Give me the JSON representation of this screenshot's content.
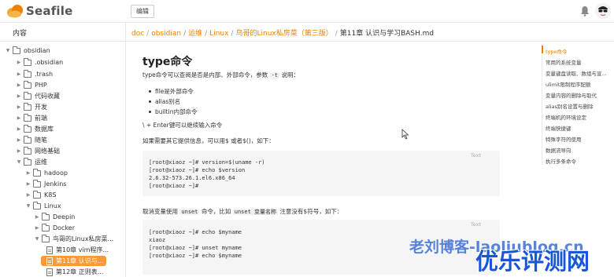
{
  "app": {
    "name": "Seafile",
    "brand_color": "#eb8205"
  },
  "toolbar": {
    "edit_label": "编辑"
  },
  "sidebar": {
    "title": "内容",
    "tree": [
      {
        "label": "obsidian",
        "type": "folder",
        "arrow": "▼"
      },
      {
        "label": ".obsidian",
        "type": "folder",
        "arrow": "▶"
      },
      {
        "label": ".trash",
        "type": "folder",
        "arrow": "▶"
      },
      {
        "label": "PHP",
        "type": "folder",
        "arrow": "▶"
      },
      {
        "label": "代码收藏",
        "type": "folder",
        "arrow": "▶"
      },
      {
        "label": "开发",
        "type": "folder",
        "arrow": "▶"
      },
      {
        "label": "前端",
        "type": "folder",
        "arrow": "▶"
      },
      {
        "label": "数据库",
        "type": "folder",
        "arrow": "▶"
      },
      {
        "label": "随笔",
        "type": "folder",
        "arrow": "▶"
      },
      {
        "label": "网络基础",
        "type": "folder",
        "arrow": "▶"
      },
      {
        "label": "运维",
        "type": "folder",
        "arrow": "▼"
      },
      {
        "label": "hadoop",
        "type": "folder",
        "arrow": "▶"
      },
      {
        "label": "Jenkins",
        "type": "folder",
        "arrow": "▶"
      },
      {
        "label": "K8S",
        "type": "folder",
        "arrow": "▶"
      },
      {
        "label": "Linux",
        "type": "folder",
        "arrow": "▼"
      },
      {
        "label": "Deepin",
        "type": "folder",
        "arrow": "▶"
      },
      {
        "label": "Docker",
        "type": "folder",
        "arrow": "▶"
      },
      {
        "label": "鸟哥的Linux私房菜...",
        "type": "folder",
        "arrow": "▼"
      },
      {
        "label": "第10章 vim程序...",
        "type": "file",
        "arrow": ""
      },
      {
        "label": "第11章 认识与...",
        "type": "file",
        "arrow": "",
        "active": true
      },
      {
        "label": "第12章 正则表...",
        "type": "file",
        "arrow": ""
      }
    ]
  },
  "breadcrumb": {
    "links": [
      "doc",
      "obsidian",
      "运维",
      "Linux",
      "鸟哥的Linux私房菜（第三版）"
    ],
    "separator": "/",
    "current": "第11章 认识与学习BASH.md"
  },
  "doc": {
    "title": "type命令",
    "intro_pre": "type命令可以查阅是否是内部、外部命令，参数 ",
    "intro_code": "-t",
    "intro_post": " 说明：",
    "bullets": [
      "file是外部命令",
      "alias别名",
      "builtin内部命令"
    ],
    "line_enter": "\\ + Enter键可以继续输入命令",
    "line_info": "如果需要其它提供信息，可以用$ 或者$()，如下：",
    "code1_lang": "Text",
    "code1": [
      "[root@xiaoz ~]# version=$(uname -r)",
      "[root@xiaoz ~]# echo $version",
      "2.6.32-573.26.1.el6.x86_64",
      "[root@xiaoz ~]#"
    ],
    "unset_pre": "取消变量使用 ",
    "unset_code1": "unset",
    "unset_mid": " 命令，比如 ",
    "unset_code2": "unset 变量名称",
    "unset_post": " 注意没有$符号，如下：",
    "code2_lang": "Text",
    "code2": [
      "[root@xiaoz ~]# echo $myname",
      "xiaoz",
      "[root@xiaoz ~]# unset myname",
      "[root@xiaoz ~]# echo $myname"
    ]
  },
  "toc": [
    "type命令",
    "常用的系统变量",
    "变量键盘读取、数组与宣...",
    "ulimit限制程序配额",
    "变量内容的删除与取代",
    "alias别名设置与删除",
    "终端机的环境设定",
    "终端快捷键",
    "特殊字符的使用",
    "数据流导向",
    "执行多条命令"
  ],
  "watermark": {
    "line1": "老刘博客-laoliublog.cn",
    "line2": "优乐评测网"
  }
}
